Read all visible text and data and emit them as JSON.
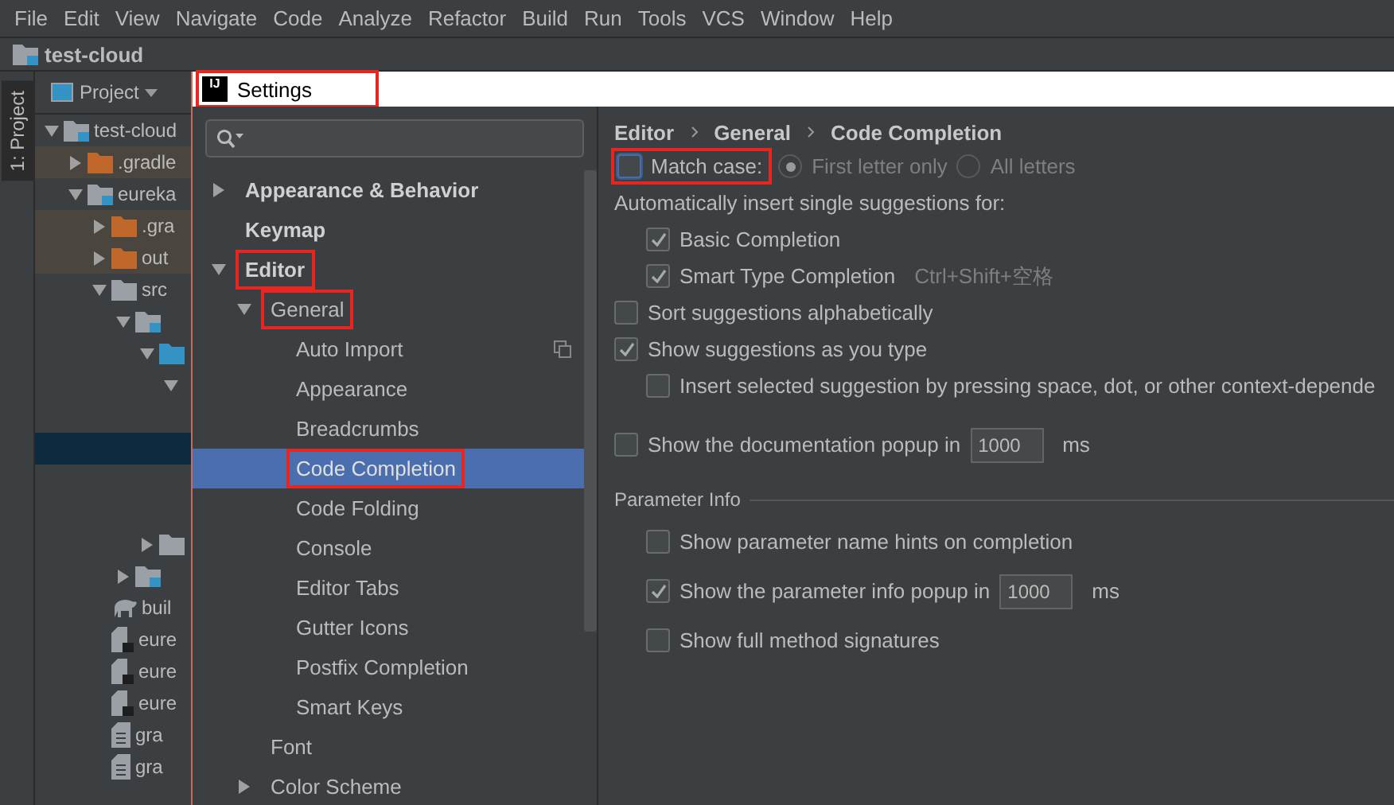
{
  "menu_bar": [
    "File",
    "Edit",
    "View",
    "Navigate",
    "Code",
    "Analyze",
    "Refactor",
    "Build",
    "Run",
    "Tools",
    "VCS",
    "Window",
    "Help"
  ],
  "breadcrumbs": [
    {
      "label": "test-cloud",
      "kind": "module"
    }
  ],
  "tool_strip": {
    "label": "1: Project"
  },
  "project_panel": {
    "title": "Project",
    "tree": [
      {
        "label": "test-cloud",
        "kind": "module",
        "expanded": true,
        "selected": false,
        "children": [
          {
            "label": ".gradle",
            "kind": "excluded",
            "expanded": false,
            "selected": false
          },
          {
            "label": "eureka",
            "kind": "module",
            "expanded": true,
            "selected": false,
            "children": [
              {
                "label": ".gra",
                "kind": "excluded",
                "expanded": false,
                "selected": false
              },
              {
                "label": "out",
                "kind": "excluded",
                "expanded": false,
                "selected": false
              },
              {
                "label": "src",
                "kind": "folder",
                "expanded": true,
                "selected": false,
                "children": [
                  {
                    "kind": "module",
                    "expanded": true,
                    "selected": false,
                    "children": [
                      {
                        "kind": "source",
                        "expanded": true,
                        "selected": false,
                        "children": [
                          {
                            "expanded": true,
                            "selected": false,
                            "children": [
                              {
                                "selected": false
                              },
                              {
                                "selected": true
                              },
                              {
                                "selected": false
                              },
                              {
                                "selected": false
                              }
                            ]
                          }
                        ]
                      },
                      {
                        "kind": "folder",
                        "expanded": false,
                        "selected": false
                      }
                    ]
                  },
                  {
                    "kind": "module",
                    "expanded": false,
                    "selected": false
                  }
                ]
              },
              {
                "label": "buil",
                "kind": "gradle",
                "selected": false
              },
              {
                "label": "eure",
                "kind": "script",
                "selected": false
              },
              {
                "label": "eure",
                "kind": "script",
                "selected": false
              },
              {
                "label": "eure",
                "kind": "script",
                "selected": false
              },
              {
                "label": "gra",
                "kind": "text",
                "selected": false
              },
              {
                "label": "gra",
                "kind": "text",
                "selected": false
              }
            ]
          }
        ]
      }
    ]
  },
  "settings": {
    "app_logo": "IJ",
    "title": "Settings",
    "title_highlighted": true,
    "tree": [
      {
        "label": "Appearance & Behavior",
        "expanded": false,
        "selected": false,
        "highlighted": false
      },
      {
        "label": "Keymap",
        "selected": false,
        "highlighted": false
      },
      {
        "label": "Editor",
        "expanded": true,
        "selected": false,
        "highlighted": true,
        "children": [
          {
            "label": "General",
            "expanded": true,
            "selected": false,
            "highlighted": true,
            "children": [
              {
                "label": "Auto Import",
                "selected": false,
                "highlighted": false,
                "project_scope": true
              },
              {
                "label": "Appearance",
                "selected": false,
                "highlighted": false,
                "project_scope": false
              },
              {
                "label": "Breadcrumbs",
                "selected": false,
                "highlighted": false,
                "project_scope": false
              },
              {
                "label": "Code Completion",
                "selected": true,
                "highlighted": true,
                "project_scope": false
              },
              {
                "label": "Code Folding",
                "selected": false,
                "highlighted": false,
                "project_scope": false
              },
              {
                "label": "Console",
                "selected": false,
                "highlighted": false,
                "project_scope": false
              },
              {
                "label": "Editor Tabs",
                "selected": false,
                "highlighted": false,
                "project_scope": false
              },
              {
                "label": "Gutter Icons",
                "selected": false,
                "highlighted": false,
                "project_scope": false
              },
              {
                "label": "Postfix Completion",
                "selected": false,
                "highlighted": false,
                "project_scope": false
              },
              {
                "label": "Smart Keys",
                "selected": false,
                "highlighted": false,
                "project_scope": false
              }
            ]
          },
          {
            "label": "Font",
            "selected": false,
            "highlighted": false
          },
          {
            "label": "Color Scheme",
            "expanded": false,
            "selected": false,
            "highlighted": false
          }
        ]
      }
    ],
    "path": [
      "Editor",
      "General",
      "Code Completion"
    ],
    "match_case": {
      "label": "Match case:",
      "checked": false,
      "highlighted": true,
      "options": [
        {
          "label": "First letter only",
          "selected": true,
          "disabled": true
        },
        {
          "label": "All letters",
          "selected": false,
          "disabled": true
        }
      ]
    },
    "options": [
      {
        "kind": "label",
        "label": "Automatically insert single suggestions for:",
        "children": [
          {
            "kind": "checkbox",
            "label": "Basic Completion",
            "checked": true
          },
          {
            "kind": "checkbox",
            "label": "Smart Type Completion",
            "checked": true,
            "shortcut": "Ctrl+Shift+空格"
          }
        ]
      },
      {
        "kind": "checkbox",
        "label": "Sort suggestions alphabetically",
        "checked": false
      },
      {
        "kind": "checkbox",
        "label": "Show suggestions as you type",
        "checked": true,
        "children": [
          {
            "kind": "checkbox",
            "label": "Insert selected suggestion by pressing space, dot, or other context-depende",
            "checked": false
          }
        ]
      },
      {
        "kind": "checkbox",
        "label": "Show the documentation popup in",
        "checked": false,
        "value": "1000",
        "unit": "ms"
      },
      {
        "kind": "section",
        "label": "Parameter Info",
        "children": [
          {
            "kind": "checkbox",
            "label": "Show parameter name hints on completion",
            "checked": false
          },
          {
            "kind": "checkbox",
            "label": "Show the parameter info popup in",
            "checked": true,
            "value": "1000",
            "unit": "ms"
          },
          {
            "kind": "checkbox",
            "label": "Show full method signatures",
            "checked": false
          }
        ]
      }
    ]
  }
}
